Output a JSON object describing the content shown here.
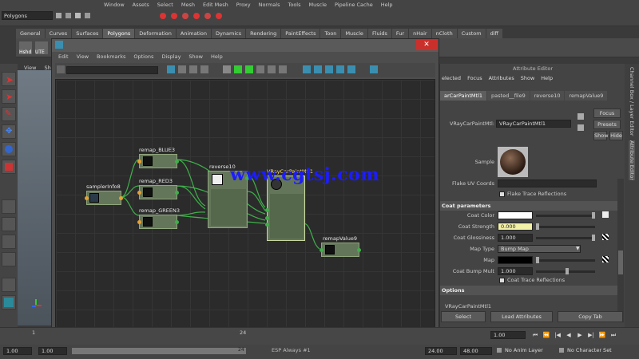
{
  "menubar": [
    "Window",
    "Assets",
    "Select",
    "Mesh",
    "Edit Mesh",
    "Proxy",
    "Normals",
    "Tools",
    "Muscle",
    "Pipeline Cache",
    "Help"
  ],
  "mode_select": "Polygons",
  "shelf_tabs": [
    {
      "label": "General"
    },
    {
      "label": "Curves"
    },
    {
      "label": "Surfaces"
    },
    {
      "label": "Polygons"
    },
    {
      "label": "Deformation"
    },
    {
      "label": "Animation"
    },
    {
      "label": "Dynamics"
    },
    {
      "label": "Rendering"
    },
    {
      "label": "PaintEffects"
    },
    {
      "label": "Toon"
    },
    {
      "label": "Muscle"
    },
    {
      "label": "Fluids"
    },
    {
      "label": "Fur"
    },
    {
      "label": "nHair"
    },
    {
      "label": "nCloth"
    },
    {
      "label": "Custom"
    },
    {
      "label": "diff"
    }
  ],
  "shelf_icons": [
    "Hshd",
    "UTE"
  ],
  "viewport_menus": [
    "View",
    "Sh"
  ],
  "hypershade": {
    "menus": [
      "Edit",
      "View",
      "Bookmarks",
      "Options",
      "Display",
      "Show",
      "Help"
    ],
    "close_label": "✕"
  },
  "nodes": {
    "sampler": "samplerInfo8",
    "remap_blue": "remap_BLUE3",
    "remap_red": "remap_RED3",
    "remap_green": "remap_GREEN3",
    "reverse": "reverse10",
    "vray": "VRayCarPaintMtl1",
    "remap_value": "remapValue9"
  },
  "watermark": "www.cgtsj.com",
  "attribute_editor": {
    "title": "Attribute Editor",
    "menus": [
      "elected",
      "Focus",
      "Attributes",
      "Show",
      "Help"
    ],
    "tabs": [
      {
        "label": "arCarPaintMtl1"
      },
      {
        "label": "pasted__file9"
      },
      {
        "label": "reverse10"
      },
      {
        "label": "remapValue9"
      }
    ],
    "node_type_label": "VRayCarPaintMtl:",
    "node_name": "VRayCarPaintMtl1",
    "focus": "Focus",
    "presets": "Presets",
    "show": "Show",
    "hide": "Hide",
    "sample_label": "Sample",
    "flake_uv": "Flake UV Coords",
    "flake_trace": "Flake Trace Reflections",
    "coat_section": "Coat parameters",
    "coat_color_label": "Coat Color",
    "coat_strength_label": "Coat Strength",
    "coat_strength_value": "0.000",
    "coat_gloss_label": "Coat Glossiness",
    "coat_gloss_value": "1.000",
    "map_type_label": "Map Type",
    "map_type_value": "Bump Map",
    "map_label": "Map",
    "coat_bump_label": "Coat Bump Mult",
    "coat_bump_value": "1.000",
    "coat_trace": "Coat Trace Reflections",
    "options_section": "Options",
    "footer_node": "VRayCarPaintMtl1",
    "select": "Select",
    "load_attributes": "Load Attributes",
    "copy_tab": "Copy Tab"
  },
  "right_vtabs": [
    "Channel Box / Layer Editor",
    "Attribute Editor"
  ],
  "timeline": {
    "start_tick": "1",
    "current": "1.00",
    "tick_mid": "24"
  },
  "range": {
    "start": "1.00",
    "start2": "1.00",
    "end_tick": "24",
    "end": "24.00",
    "end2": "48.00",
    "anim_layer": "No Anim Layer",
    "char_set": "No Character Set",
    "cut_text": "ESP Always #1"
  },
  "colors": {
    "node_fill": "#64765a",
    "connection": "#3fb04a",
    "watermark": "#1c1cff",
    "close": "#c9302c"
  }
}
